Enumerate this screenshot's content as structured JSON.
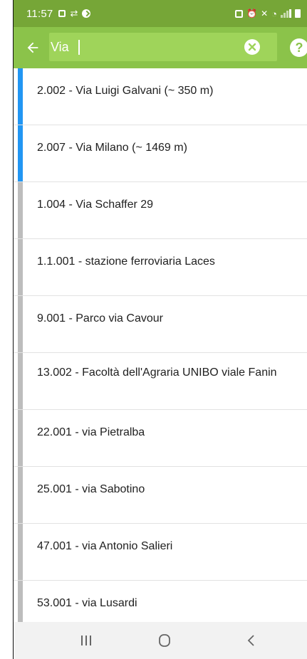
{
  "status_bar": {
    "time": "11:57"
  },
  "toolbar": {
    "search_value": "Via",
    "help_label": "?"
  },
  "results": [
    {
      "label": "2.002 - Via Luigi Galvani (~ 350 m)",
      "active": true
    },
    {
      "label": "2.007 - Via Milano (~ 1469 m)",
      "active": true
    },
    {
      "label": "1.004 - Via Schaffer 29",
      "active": false
    },
    {
      "label": "1.1.001 - stazione ferroviaria Laces",
      "active": false
    },
    {
      "label": "9.001 - Parco via Cavour",
      "active": false
    },
    {
      "label": "13.002 - Facoltà dell'Agraria UNIBO viale Fanin",
      "active": false
    },
    {
      "label": "22.001 - via Pietralba",
      "active": false
    },
    {
      "label": "25.001 - via Sabotino",
      "active": false
    },
    {
      "label": "47.001 - via Antonio Salieri",
      "active": false
    },
    {
      "label": "53.001 - via Lusardi",
      "active": false
    }
  ],
  "colors": {
    "status_bar": "#76a637",
    "toolbar": "#8bc34a",
    "active_indicator": "#2196f3",
    "inactive_indicator": "#bdbdbd"
  },
  "icons": {
    "back": "arrow-left-icon",
    "clear": "clear-circle-icon",
    "help": "help-icon",
    "nav_recents": "recents-icon",
    "nav_home": "home-icon",
    "nav_back": "nav-back-icon"
  }
}
